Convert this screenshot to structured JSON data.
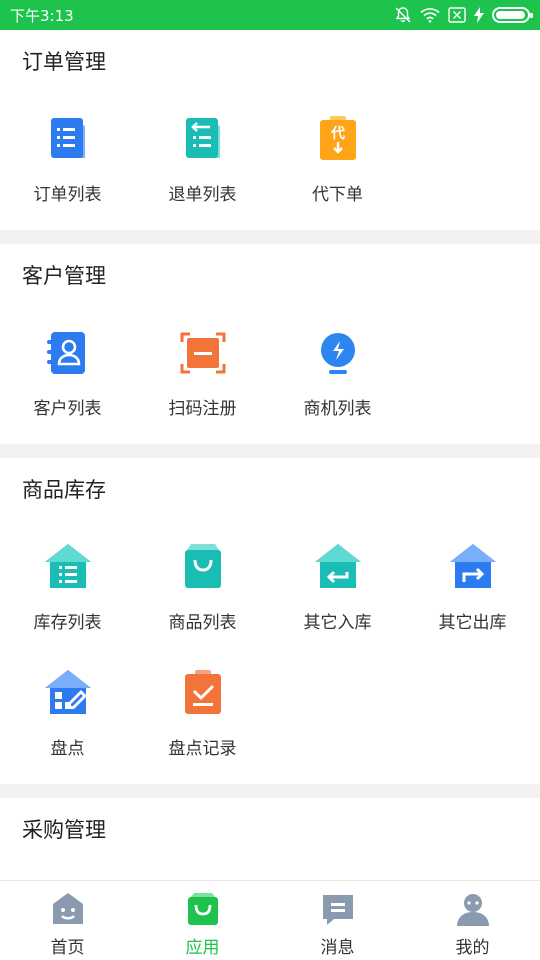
{
  "status_bar": {
    "time": "下午3:13",
    "battery_level": 0.95
  },
  "sections": [
    {
      "title": "订单管理",
      "items": [
        {
          "label": "订单列表",
          "icon": "document-list-icon",
          "color": "#2d7bf0"
        },
        {
          "label": "退单列表",
          "icon": "return-list-icon",
          "color": "#19bdb4"
        },
        {
          "label": "代下单",
          "icon": "proxy-order-icon",
          "icon_text": "代",
          "color": "#ffa417"
        }
      ]
    },
    {
      "title": "客户管理",
      "items": [
        {
          "label": "客户列表",
          "icon": "contacts-book-icon",
          "color": "#2d7bf0"
        },
        {
          "label": "扫码注册",
          "icon": "scan-register-icon",
          "color": "#f3743a"
        },
        {
          "label": "商机列表",
          "icon": "lightbulb-icon",
          "color": "#2d85f0"
        }
      ]
    },
    {
      "title": "商品库存",
      "items": [
        {
          "label": "库存列表",
          "icon": "warehouse-list-icon",
          "color": "#19bdb4"
        },
        {
          "label": "商品列表",
          "icon": "shopping-bag-icon",
          "color": "#19bdb4"
        },
        {
          "label": "其它入库",
          "icon": "warehouse-in-icon",
          "color": "#19bdb4"
        },
        {
          "label": "其它出库",
          "icon": "warehouse-out-icon",
          "color": "#2d7bf0"
        },
        {
          "label": "盘点",
          "icon": "inventory-check-icon",
          "color": "#2d7bf0"
        },
        {
          "label": "盘点记录",
          "icon": "checklist-record-icon",
          "color": "#f3743a"
        }
      ]
    },
    {
      "title": "采购管理",
      "items": [
        {
          "label": "",
          "icon": "purchase-cart-icon",
          "color": "#2d7bf0"
        },
        {
          "label": "",
          "icon": "purchase-cart-icon",
          "color": "#f3743a"
        }
      ]
    }
  ],
  "tabs": [
    {
      "label": "首页",
      "icon": "home-face-icon",
      "active": false
    },
    {
      "label": "应用",
      "icon": "apps-bag-icon",
      "active": true
    },
    {
      "label": "消息",
      "icon": "message-icon",
      "active": false
    },
    {
      "label": "我的",
      "icon": "profile-icon",
      "active": false
    }
  ],
  "colors": {
    "status_bar": "#1ec34d",
    "active_tab": "#1ec34d",
    "inactive_tab_icon": "#8a9bb0"
  }
}
